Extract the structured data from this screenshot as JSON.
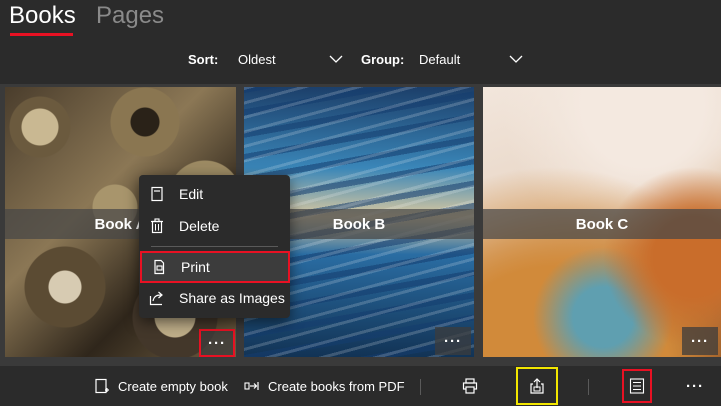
{
  "tabs": [
    {
      "label": "Books",
      "active": true
    },
    {
      "label": "Pages",
      "active": false
    }
  ],
  "filters": {
    "sort_label": "Sort:",
    "sort_value": "Oldest",
    "group_label": "Group:",
    "group_value": "Default"
  },
  "books": [
    {
      "title": "Book A",
      "more": "···"
    },
    {
      "title": "Book B",
      "more": "···"
    },
    {
      "title": "Book C",
      "more": "···"
    }
  ],
  "context_menu": {
    "items": [
      {
        "label": "Edit",
        "icon": "edit-icon"
      },
      {
        "label": "Delete",
        "icon": "trash-icon"
      },
      {
        "label": "Print",
        "icon": "print-icon"
      },
      {
        "label": "Share as Images",
        "icon": "share-icon"
      }
    ]
  },
  "toolbar": {
    "create_empty_label": "Create empty book",
    "create_from_pdf_label": "Create books from PDF",
    "more_label": "···"
  },
  "colors": {
    "accent_red": "#e81123",
    "highlight_yellow": "#f2e600",
    "background": "#2b2b2b"
  }
}
